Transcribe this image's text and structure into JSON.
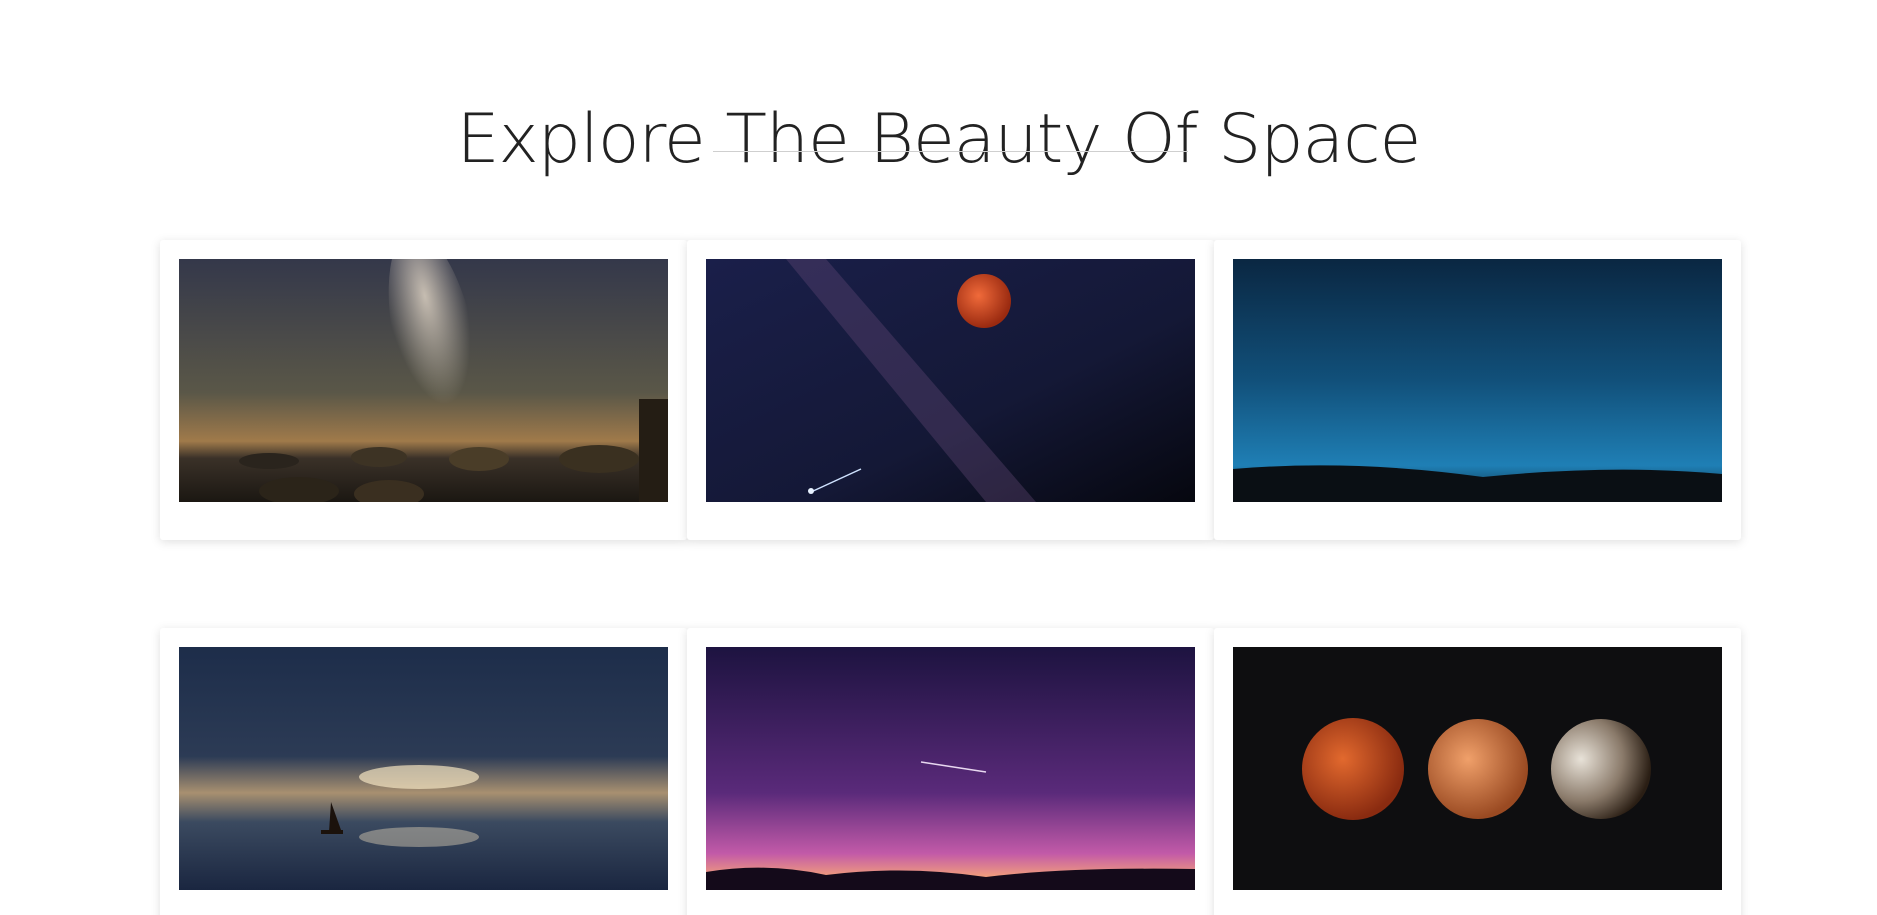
{
  "page": {
    "title": "Explore The Beauty Of Space"
  },
  "gallery": {
    "cards": [
      {
        "subject": "milky-way-over-rocky-sea",
        "accent": "#c9a06a"
      },
      {
        "subject": "blood-moon-and-shooting-star",
        "accent": "#c8401c"
      },
      {
        "subject": "blue-starry-sky-over-hills",
        "accent": "#1f7fb5"
      },
      {
        "subject": "sailboat-under-night-sky",
        "accent": "#e8b77a"
      },
      {
        "subject": "purple-starry-sky-with-meteor",
        "accent": "#b04fb0"
      },
      {
        "subject": "three-lunar-eclipse-phases",
        "accent": "#b8441a"
      }
    ]
  }
}
